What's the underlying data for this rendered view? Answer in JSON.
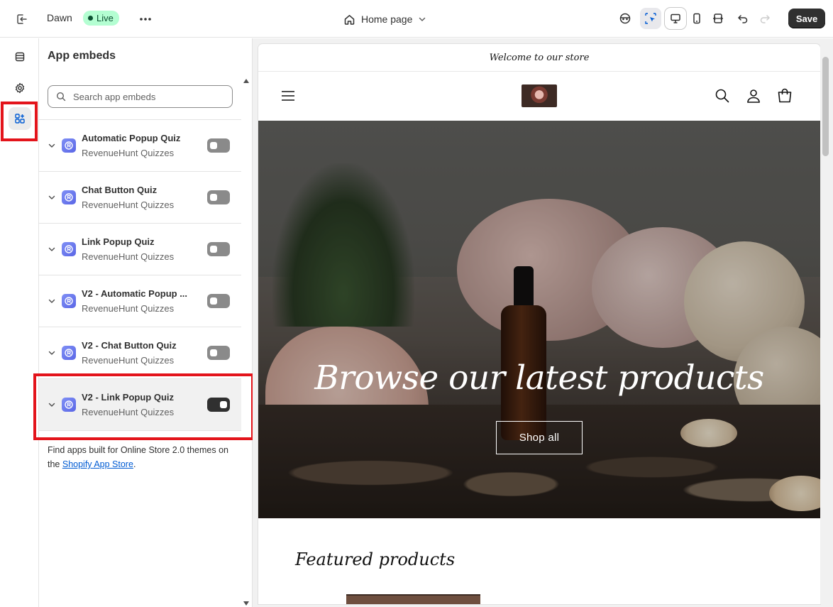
{
  "topbar": {
    "theme_name": "Dawn",
    "status_badge": "Live",
    "page_selector": "Home page",
    "save_label": "Save"
  },
  "panel": {
    "title": "App embeds",
    "search_placeholder": "Search app embeds",
    "items": [
      {
        "name": "Automatic Popup Quiz",
        "provider": "RevenueHunt Quizzes",
        "enabled": false
      },
      {
        "name": "Chat Button Quiz",
        "provider": "RevenueHunt Quizzes",
        "enabled": false
      },
      {
        "name": "Link Popup Quiz",
        "provider": "RevenueHunt Quizzes",
        "enabled": false
      },
      {
        "name": "V2 - Automatic Popup ...",
        "provider": "RevenueHunt Quizzes",
        "enabled": false
      },
      {
        "name": "V2 - Chat Button Quiz",
        "provider": "RevenueHunt Quizzes",
        "enabled": false
      },
      {
        "name": "V2 - Link Popup Quiz",
        "provider": "RevenueHunt Quizzes",
        "enabled": true
      }
    ],
    "footer_text": "Find apps built for Online Store 2.0 themes on the ",
    "footer_link": "Shopify App Store",
    "footer_end": "."
  },
  "preview": {
    "announcement": "Welcome to our store",
    "hero_heading": "Browse our latest products",
    "hero_button": "Shop all",
    "featured_title": "Featured products"
  },
  "colors": {
    "highlight": "#e3141b",
    "live_badge_bg": "#b4fed2",
    "save_bg": "#303030",
    "link": "#005bd3"
  },
  "icons": {
    "exit": "exit-icon",
    "more": "ellipsis-icon",
    "home": "home-icon",
    "sections": "sections-icon",
    "settings": "gear-icon",
    "app_embeds": "apps-icon"
  }
}
